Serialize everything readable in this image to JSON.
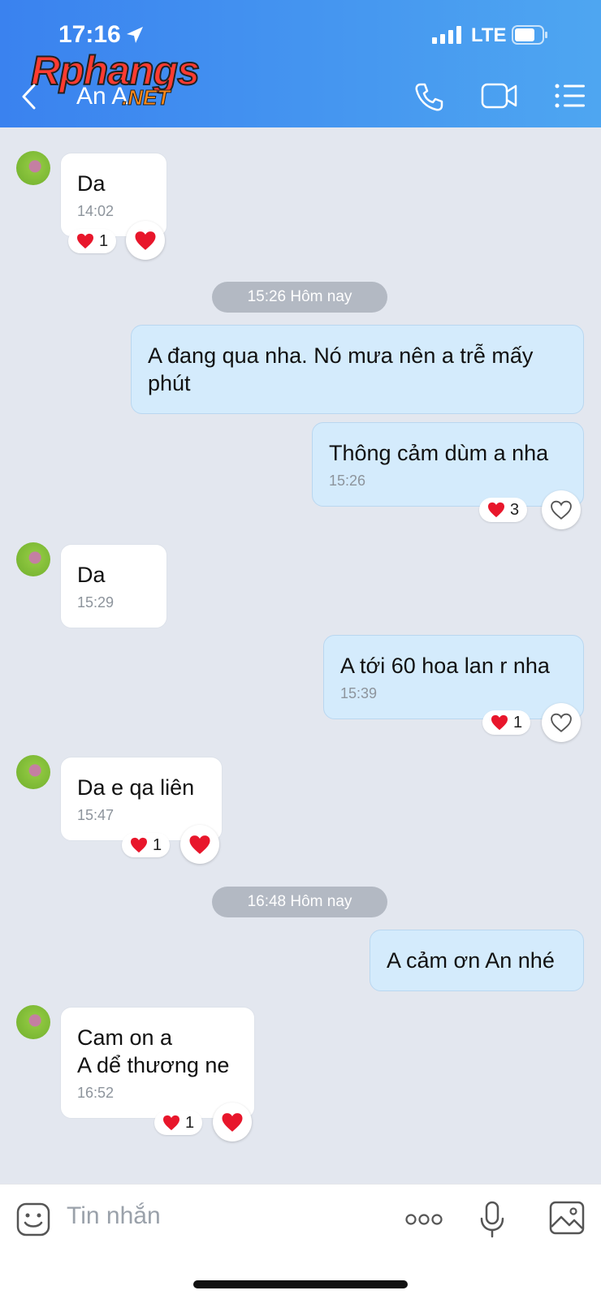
{
  "status_bar": {
    "time": "17:16",
    "network": "LTE"
  },
  "header": {
    "title": "An A",
    "watermark": "Rphangs",
    "watermark_suffix": ".NET"
  },
  "colors": {
    "header": "#3a82ef",
    "outgoing_bubble": "#d4ebfc",
    "incoming_bubble": "#ffffff",
    "heart": "#e8162b"
  },
  "messages": [
    {
      "text": "Da",
      "time": "14:02",
      "reaction_count": "1"
    },
    {
      "divider": "15:26 Hôm nay"
    },
    {
      "text": "A đang qua nha. Nó mưa nên a trễ mấy phút"
    },
    {
      "text": "Thông cảm dùm a nha",
      "time": "15:26",
      "reaction_count": "3"
    },
    {
      "text": "Da",
      "time": "15:29"
    },
    {
      "text": "A tới 60 hoa lan r nha",
      "time": "15:39",
      "reaction_count": "1"
    },
    {
      "text": "Da e qa liên",
      "time": "15:47",
      "reaction_count": "1"
    },
    {
      "divider": "16:48 Hôm nay"
    },
    {
      "text": "A cảm ơn An nhé"
    },
    {
      "line1": "Cam on a",
      "line2": "A dể thương ne",
      "time": "16:52",
      "reaction_count": "1"
    }
  ],
  "composer": {
    "placeholder": "Tin nhắn"
  },
  "icons": [
    "location-arrow-icon",
    "signal-icon",
    "battery-icon",
    "back-icon",
    "phone-icon",
    "video-icon",
    "menu-icon",
    "heart-icon",
    "heart-outline-icon",
    "sticker-icon",
    "more-icon",
    "mic-icon",
    "image-icon"
  ]
}
